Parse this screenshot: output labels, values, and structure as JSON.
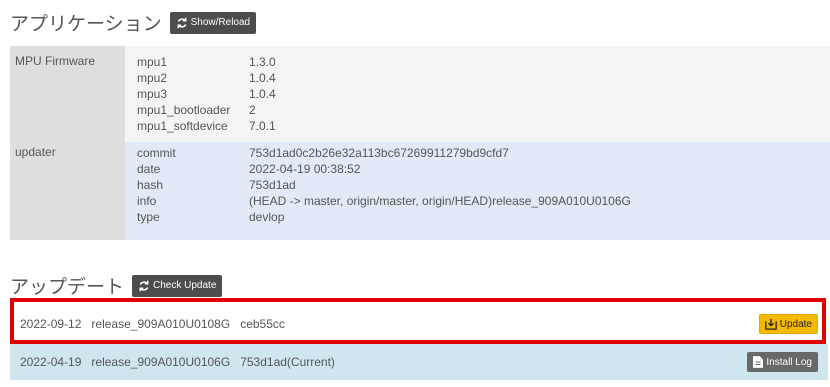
{
  "app_section": {
    "title": "アプリケーション",
    "reload_button": "Show/Reload"
  },
  "info_table": {
    "mpu_label": "MPU Firmware",
    "mpu_keys": [
      "mpu1",
      "mpu2",
      "mpu3",
      "mpu1_bootloader",
      "mpu1_softdevice"
    ],
    "mpu_values": [
      "1.3.0",
      "1.0.4",
      "1.0.4",
      "2",
      "7.0.1"
    ],
    "updater_label": "updater",
    "updater_keys": [
      "commit",
      "date",
      "hash",
      "info",
      "type"
    ],
    "updater_values": [
      "753d1ad0c2b26e32a113bc67269911279bd9cfd7",
      "2022-04-19 00:38:52",
      "753d1ad",
      "(HEAD -> master, origin/master, origin/HEAD)release_909A010U0106G",
      "devlop"
    ]
  },
  "update_section": {
    "title": "アップデート",
    "check_button": "Check Update",
    "rows": [
      {
        "date": "2022-09-12",
        "release": "release_909A010U0108G",
        "hash": "ceb55cc",
        "action": "Update"
      },
      {
        "date": "2022-04-19",
        "release": "release_909A010U0106G",
        "hash": "753d1ad(Current)",
        "action": "Install Log"
      }
    ]
  },
  "colors": {
    "highlight_border": "#e00000",
    "current_row_bg": "#cfe6ef",
    "update_button_bg": "#f6b800"
  }
}
